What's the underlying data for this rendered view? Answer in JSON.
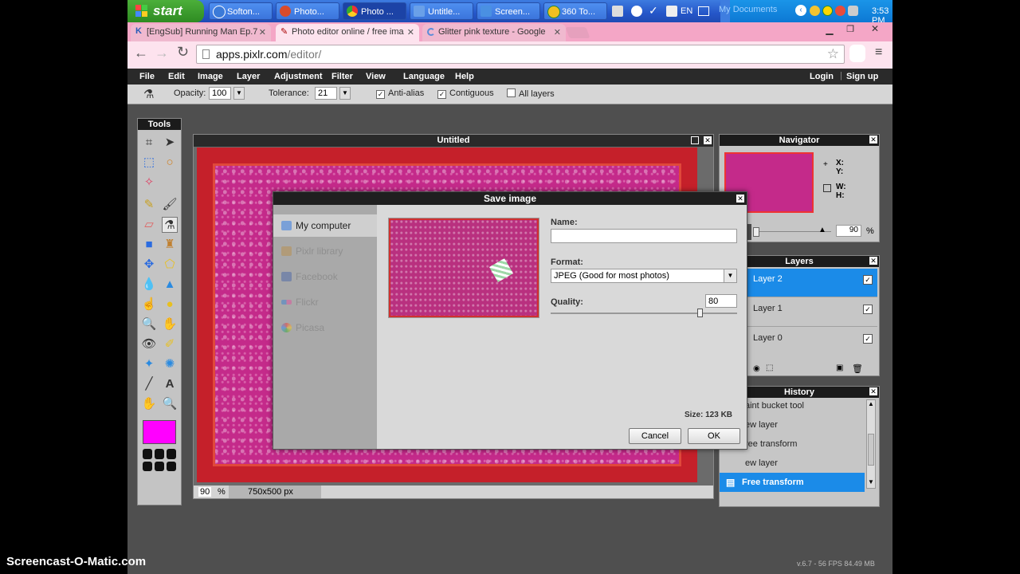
{
  "taskbar": {
    "start_label": "start",
    "buttons": [
      {
        "label": "Softon...",
        "icon": "softonic-icon",
        "color": "#3b7ad8"
      },
      {
        "label": "Photo...",
        "icon": "photo-app-icon",
        "color": "#d94b2b"
      },
      {
        "label": "Photo ...",
        "icon": "chrome-icon",
        "color": "#e8b130"
      },
      {
        "label": "Untitle...",
        "icon": "document-icon",
        "color": "#6aa0e8"
      },
      {
        "label": "Screen...",
        "icon": "screen-icon",
        "color": "#4a90e2"
      },
      {
        "label": "360 To...",
        "icon": "antivirus-icon",
        "color": "#f0c020"
      }
    ],
    "language": "EN",
    "my_documents": "My Documents",
    "clock": "3:53 PM"
  },
  "browser": {
    "tabs": [
      {
        "label": "[EngSub] Running Man Ep.7",
        "icon": "k-icon",
        "color": "#2a5cb8"
      },
      {
        "label": "Photo editor online / free ima",
        "icon": "pixlr-icon",
        "color": "#2a5cb8"
      },
      {
        "label": "Glitter pink texture - Google",
        "icon": "loading-icon",
        "color": "#2a5cb8"
      }
    ],
    "url_host": "apps.pixlr.com",
    "url_path": "/editor/"
  },
  "menubar": {
    "items": [
      "File",
      "Edit",
      "Image",
      "Layer",
      "Adjustment",
      "Filter",
      "View",
      "Language",
      "Help"
    ],
    "login": "Login",
    "signup": "Sign up"
  },
  "options": {
    "opacity_label": "Opacity:",
    "opacity_value": "100",
    "tolerance_label": "Tolerance:",
    "tolerance_value": "21",
    "antialias": "Anti-alias",
    "contiguous": "Contiguous",
    "all_layers": "All layers"
  },
  "tools": {
    "title": "Tools",
    "primary_color": "#ff00ff"
  },
  "canvas": {
    "title": "Untitled",
    "zoom": "90",
    "zoom_unit": "%",
    "dimensions": "750x500 px"
  },
  "dialog": {
    "title": "Save image",
    "destinations": [
      "My computer",
      "Pixlr library",
      "Facebook",
      "Flickr",
      "Picasa"
    ],
    "name_label": "Name:",
    "name_value": "",
    "format_label": "Format:",
    "format_value": "JPEG (Good for most photos)",
    "quality_label": "Quality:",
    "quality_value": "80",
    "quality_level": 0.8,
    "size_label": "Size: 123 KB",
    "cancel": "Cancel",
    "ok": "OK"
  },
  "navigator": {
    "title": "Navigator",
    "x_label": "X:",
    "y_label": "Y:",
    "w_label": "W:",
    "h_label": "H:",
    "zoom": "90",
    "zoom_unit": "%"
  },
  "layers": {
    "title": "Layers",
    "items": [
      "Layer 2",
      "Layer 1",
      "Layer 0"
    ]
  },
  "history": {
    "title": "History",
    "items": [
      "aint bucket tool",
      "ew layer",
      "ree transform",
      "ew layer",
      "Free transform"
    ]
  },
  "footer": {
    "watermark": "Screencast-O-Matic.com",
    "version": "v.6.7 - 56 FPS 84.49 MB"
  }
}
